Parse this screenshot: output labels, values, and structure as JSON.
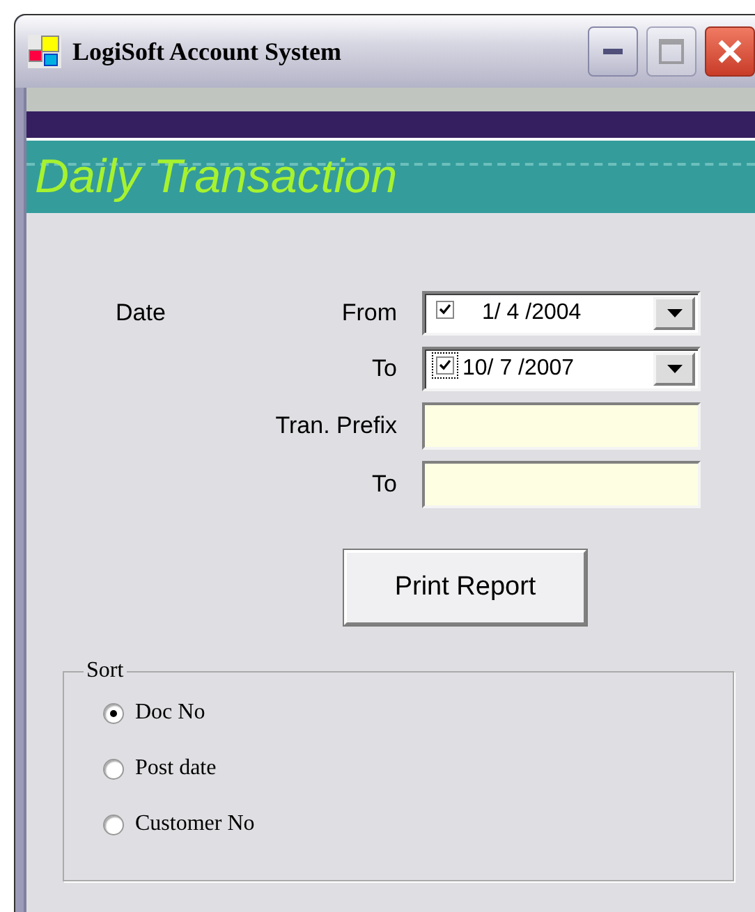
{
  "window": {
    "title": "LogiSoft Account System"
  },
  "header": {
    "title": "Daily Transaction"
  },
  "form": {
    "date_label": "Date",
    "dates": [
      {
        "label": "From",
        "checked": true,
        "focused": false,
        "value": "1/ 4 /2004"
      },
      {
        "label": "To",
        "checked": true,
        "focused": true,
        "value": "10/ 7 /2007"
      }
    ],
    "prefixes": [
      {
        "label": "Tran. Prefix"
      },
      {
        "label": "To"
      }
    ]
  },
  "print_button": "Print Report",
  "sort": {
    "title": "Sort",
    "options": [
      {
        "label": "Doc No",
        "selected": true
      },
      {
        "label": "Post date",
        "selected": false
      },
      {
        "label": "Customer No",
        "selected": false
      }
    ]
  }
}
